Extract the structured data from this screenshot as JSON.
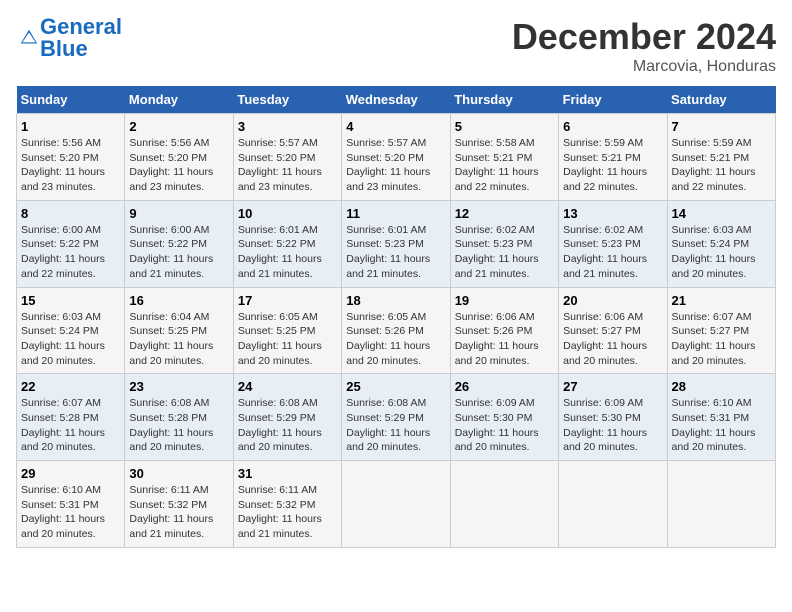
{
  "logo": {
    "line1": "General",
    "line2": "Blue"
  },
  "title": "December 2024",
  "location": "Marcovia, Honduras",
  "weekdays": [
    "Sunday",
    "Monday",
    "Tuesday",
    "Wednesday",
    "Thursday",
    "Friday",
    "Saturday"
  ],
  "weeks": [
    [
      {
        "day": "1",
        "sunrise": "5:56 AM",
        "sunset": "5:20 PM",
        "daylight": "11 hours and 23 minutes."
      },
      {
        "day": "2",
        "sunrise": "5:56 AM",
        "sunset": "5:20 PM",
        "daylight": "11 hours and 23 minutes."
      },
      {
        "day": "3",
        "sunrise": "5:57 AM",
        "sunset": "5:20 PM",
        "daylight": "11 hours and 23 minutes."
      },
      {
        "day": "4",
        "sunrise": "5:57 AM",
        "sunset": "5:20 PM",
        "daylight": "11 hours and 23 minutes."
      },
      {
        "day": "5",
        "sunrise": "5:58 AM",
        "sunset": "5:21 PM",
        "daylight": "11 hours and 22 minutes."
      },
      {
        "day": "6",
        "sunrise": "5:59 AM",
        "sunset": "5:21 PM",
        "daylight": "11 hours and 22 minutes."
      },
      {
        "day": "7",
        "sunrise": "5:59 AM",
        "sunset": "5:21 PM",
        "daylight": "11 hours and 22 minutes."
      }
    ],
    [
      {
        "day": "8",
        "sunrise": "6:00 AM",
        "sunset": "5:22 PM",
        "daylight": "11 hours and 22 minutes."
      },
      {
        "day": "9",
        "sunrise": "6:00 AM",
        "sunset": "5:22 PM",
        "daylight": "11 hours and 21 minutes."
      },
      {
        "day": "10",
        "sunrise": "6:01 AM",
        "sunset": "5:22 PM",
        "daylight": "11 hours and 21 minutes."
      },
      {
        "day": "11",
        "sunrise": "6:01 AM",
        "sunset": "5:23 PM",
        "daylight": "11 hours and 21 minutes."
      },
      {
        "day": "12",
        "sunrise": "6:02 AM",
        "sunset": "5:23 PM",
        "daylight": "11 hours and 21 minutes."
      },
      {
        "day": "13",
        "sunrise": "6:02 AM",
        "sunset": "5:23 PM",
        "daylight": "11 hours and 21 minutes."
      },
      {
        "day": "14",
        "sunrise": "6:03 AM",
        "sunset": "5:24 PM",
        "daylight": "11 hours and 20 minutes."
      }
    ],
    [
      {
        "day": "15",
        "sunrise": "6:03 AM",
        "sunset": "5:24 PM",
        "daylight": "11 hours and 20 minutes."
      },
      {
        "day": "16",
        "sunrise": "6:04 AM",
        "sunset": "5:25 PM",
        "daylight": "11 hours and 20 minutes."
      },
      {
        "day": "17",
        "sunrise": "6:05 AM",
        "sunset": "5:25 PM",
        "daylight": "11 hours and 20 minutes."
      },
      {
        "day": "18",
        "sunrise": "6:05 AM",
        "sunset": "5:26 PM",
        "daylight": "11 hours and 20 minutes."
      },
      {
        "day": "19",
        "sunrise": "6:06 AM",
        "sunset": "5:26 PM",
        "daylight": "11 hours and 20 minutes."
      },
      {
        "day": "20",
        "sunrise": "6:06 AM",
        "sunset": "5:27 PM",
        "daylight": "11 hours and 20 minutes."
      },
      {
        "day": "21",
        "sunrise": "6:07 AM",
        "sunset": "5:27 PM",
        "daylight": "11 hours and 20 minutes."
      }
    ],
    [
      {
        "day": "22",
        "sunrise": "6:07 AM",
        "sunset": "5:28 PM",
        "daylight": "11 hours and 20 minutes."
      },
      {
        "day": "23",
        "sunrise": "6:08 AM",
        "sunset": "5:28 PM",
        "daylight": "11 hours and 20 minutes."
      },
      {
        "day": "24",
        "sunrise": "6:08 AM",
        "sunset": "5:29 PM",
        "daylight": "11 hours and 20 minutes."
      },
      {
        "day": "25",
        "sunrise": "6:08 AM",
        "sunset": "5:29 PM",
        "daylight": "11 hours and 20 minutes."
      },
      {
        "day": "26",
        "sunrise": "6:09 AM",
        "sunset": "5:30 PM",
        "daylight": "11 hours and 20 minutes."
      },
      {
        "day": "27",
        "sunrise": "6:09 AM",
        "sunset": "5:30 PM",
        "daylight": "11 hours and 20 minutes."
      },
      {
        "day": "28",
        "sunrise": "6:10 AM",
        "sunset": "5:31 PM",
        "daylight": "11 hours and 20 minutes."
      }
    ],
    [
      {
        "day": "29",
        "sunrise": "6:10 AM",
        "sunset": "5:31 PM",
        "daylight": "11 hours and 20 minutes."
      },
      {
        "day": "30",
        "sunrise": "6:11 AM",
        "sunset": "5:32 PM",
        "daylight": "11 hours and 21 minutes."
      },
      {
        "day": "31",
        "sunrise": "6:11 AM",
        "sunset": "5:32 PM",
        "daylight": "11 hours and 21 minutes."
      },
      null,
      null,
      null,
      null
    ]
  ]
}
